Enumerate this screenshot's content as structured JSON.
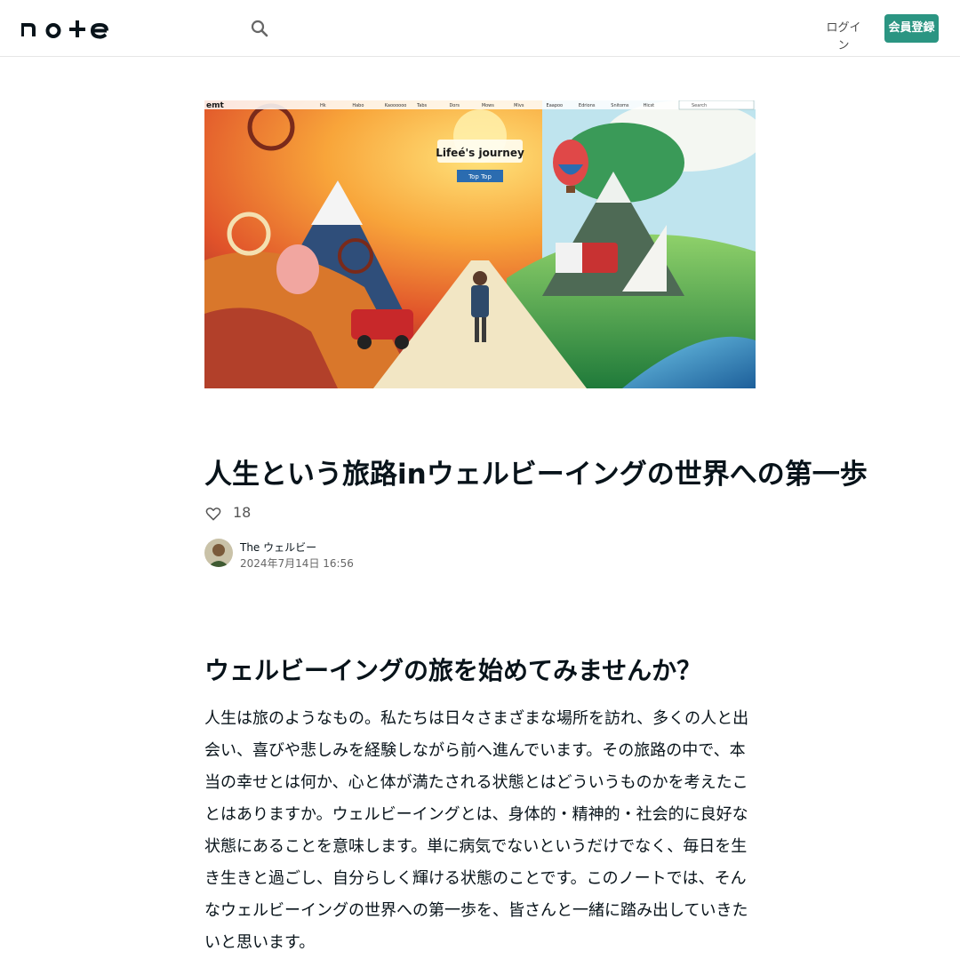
{
  "header": {
    "logo_text": "note",
    "search_icon": "search-icon",
    "login_label": "ログイン",
    "signup_label": "会員登録",
    "accent_color": "#2b9582"
  },
  "eyecatch": {
    "image_text": "Lifeé's journey",
    "button_text": "Top Top",
    "nav_items": [
      "Hk",
      "Habo",
      "Kaoooooo",
      "Tabs",
      "Dors",
      "Mows",
      "Mivs",
      "Eaapoo",
      "Edrions",
      "Snitoms",
      "Hicst"
    ],
    "search_placeholder": "Search",
    "corner_text": "emt"
  },
  "article": {
    "title": "人生という旅路inウェルビーイングの世界への第一歩",
    "like_count": "18",
    "like_icon": "heart-icon",
    "author_name": "The ウェルビー",
    "date": "2024年7月14日 16:56",
    "heading": "ウェルビーイングの旅を始めてみませんか？",
    "body": "人生は旅のようなもの。私たちは日々さまざまな場所を訪れ、多くの人と出会い、喜びや悲しみを経験しながら前へ進んでいます。その旅路の中で、本当の幸せとは何か、心と体が満たされる状態とはどういうものかを考えたことはありますか。ウェルビーイングとは、身体的・精神的・社会的に良好な状態にあることを意味します。単に病気でないというだけでなく、毎日を生き生きと過ごし、自分らしく輝ける状態のことです。このノートでは、そんなウェルビーイングの世界への第一歩を、皆さんと一緒に踏み出していきたいと思います。"
  }
}
